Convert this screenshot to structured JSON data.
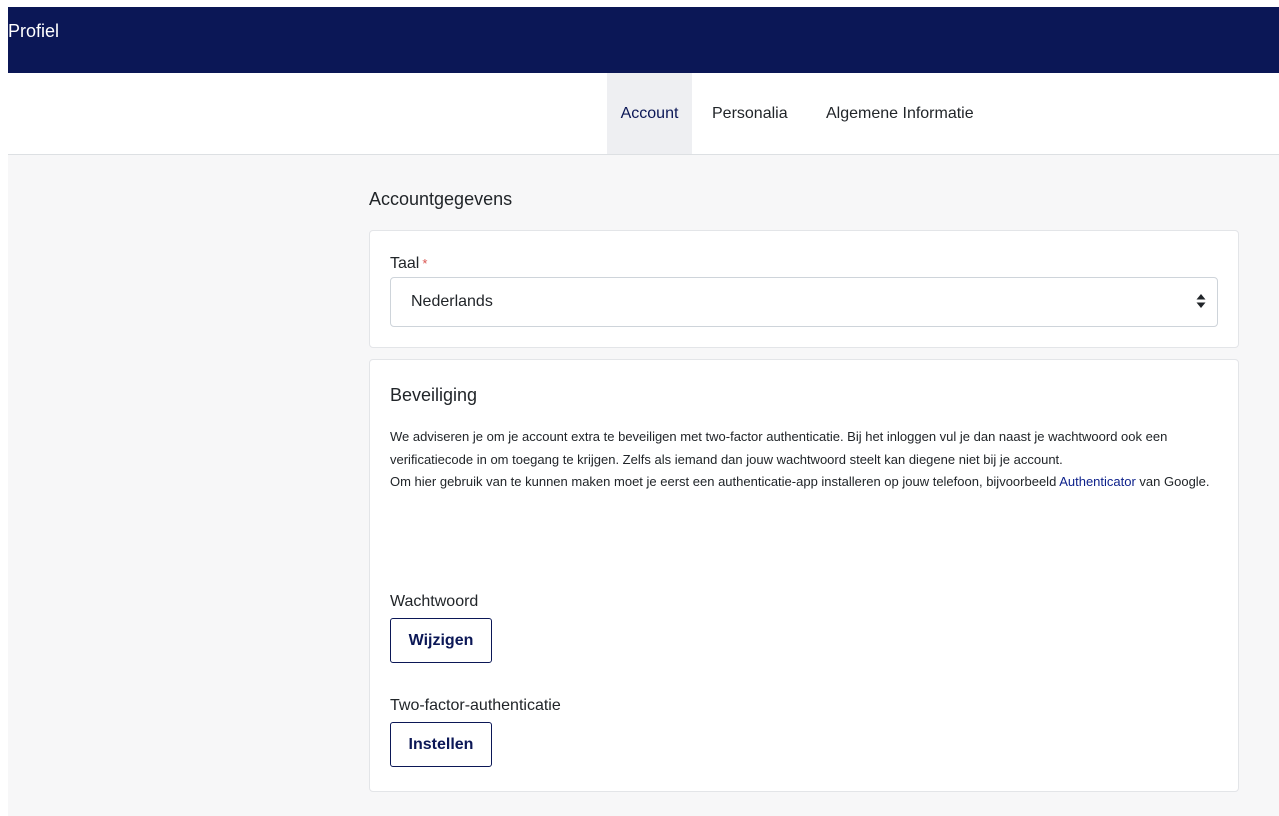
{
  "header": {
    "title": "Profiel"
  },
  "tabs": [
    {
      "label": "Account",
      "active": true
    },
    {
      "label": "Personalia",
      "active": false
    },
    {
      "label": "Algemene Informatie",
      "active": false
    }
  ],
  "main": {
    "section_title": "Accountgegevens",
    "language": {
      "label": "Taal",
      "required_marker": "*",
      "selected_value": "Nederlands"
    },
    "security": {
      "title": "Beveiliging",
      "paragraph1": "We adviseren je om je account extra te beveiligen met two-factor authenticatie. Bij het inloggen vul je dan naast je wachtwoord ook een verificatiecode in om toegang te krijgen. Zelfs als iemand dan jouw wachtwoord steelt kan diegene niet bij je account.",
      "paragraph2_prefix": "Om hier gebruik van te kunnen maken moet je eerst een authenticatie-app installeren op jouw telefoon, bijvoorbeeld ",
      "paragraph2_link": "Authenticator",
      "paragraph2_suffix": " van Google.",
      "password_label": "Wachtwoord",
      "password_button": "Wijzigen",
      "twofa_label": "Two-factor-authenticatie",
      "twofa_button": "Instellen"
    }
  },
  "colors": {
    "brand_navy": "#0b1756",
    "page_background": "#f7f7f8",
    "active_tab_background": "#eeeff2",
    "required_red": "#d9534f"
  },
  "icons": {
    "select_arrows": "sort-arrows-icon"
  }
}
